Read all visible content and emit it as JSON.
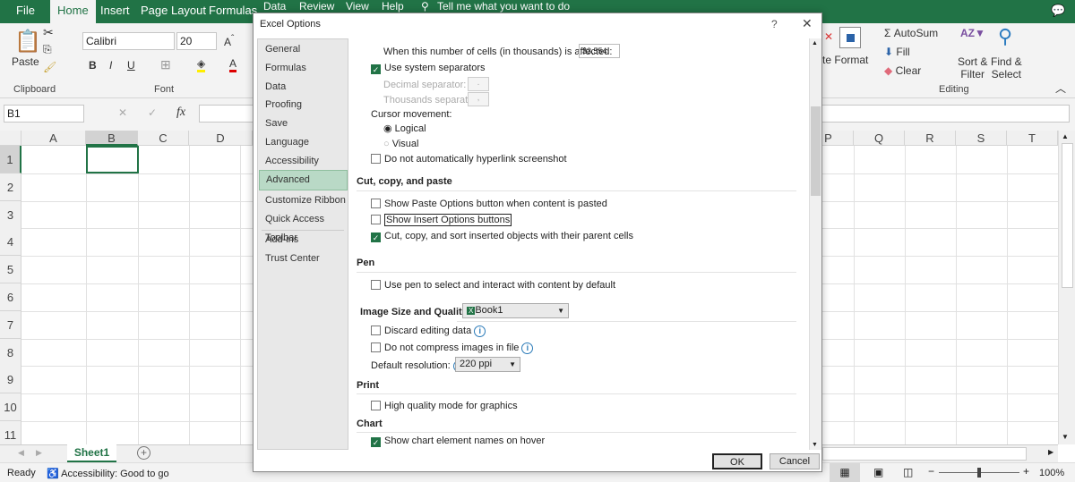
{
  "ribbon_tabs": [
    "File",
    "Home",
    "Insert",
    "Page Layout",
    "Formulas",
    "Data",
    "Review",
    "View",
    "Help",
    "Tell me what you want to do"
  ],
  "ribbon": {
    "paste": "Paste",
    "clipboard": "Clipboard",
    "font_name": "Calibri",
    "font_size": "20",
    "bold": "B",
    "italic": "I",
    "underline": "U",
    "font_group": "Font",
    "format": "Format",
    "autosum": "AutoSum",
    "fill": "Fill",
    "clear": "Clear",
    "sort_filter_1": "Sort &",
    "sort_filter_2": "Filter",
    "find_select_1": "Find &",
    "find_select_2": "Select",
    "editing": "Editing",
    "cells_partial": "te"
  },
  "formula_bar": {
    "name_box": "B1",
    "fx": "fx",
    "cancel": "✕",
    "enter": "✓"
  },
  "columns_left": [
    "A",
    "B",
    "C",
    "D"
  ],
  "columns_right": [
    "P",
    "Q",
    "R",
    "S",
    "T"
  ],
  "rows": [
    "1",
    "2",
    "3",
    "4",
    "5",
    "6",
    "7",
    "8",
    "9",
    "10",
    "11"
  ],
  "selected_cell": "B1",
  "sheet_tabs": [
    "Sheet1"
  ],
  "status": {
    "ready": "Ready",
    "accessibility": "Accessibility: Good to go",
    "zoom": "100%"
  },
  "dialog": {
    "title": "Excel Options",
    "help": "?",
    "close": "✕",
    "nav": [
      "General",
      "Formulas",
      "Data",
      "Proofing",
      "Save",
      "Language",
      "Accessibility",
      "Advanced",
      "Customize Ribbon",
      "Quick Access Toolbar",
      "Add-ins",
      "Trust Center"
    ],
    "selected_nav": "Advanced",
    "cells_affected_label": "When this number of cells (in thousands) is affected:",
    "cells_affected_value": "33,554",
    "use_system_separators": {
      "label": "Use system separators",
      "checked": true
    },
    "decimal_separator": {
      "label": "Decimal separator:",
      "value": "."
    },
    "thousands_separator": {
      "label": "Thousands separator:",
      "value": ","
    },
    "cursor_movement": "Cursor movement:",
    "logical": {
      "label": "Logical",
      "selected": true
    },
    "visual": {
      "label": "Visual",
      "selected": false
    },
    "no_hyperlink": {
      "label": "Do not automatically hyperlink screenshot",
      "checked": false
    },
    "sec_cut": "Cut, copy, and paste",
    "show_paste": {
      "label": "Show Paste Options button when content is pasted",
      "checked": false
    },
    "show_insert": {
      "label": "Show Insert Options buttons",
      "checked": false
    },
    "cut_sort": {
      "label": "Cut, copy, and sort inserted objects with their parent cells",
      "checked": true
    },
    "sec_pen": "Pen",
    "use_pen": {
      "label": "Use pen to select and interact with content by default",
      "checked": false
    },
    "sec_image": "Image Size and Quality",
    "image_book": "Book1",
    "discard": {
      "label": "Discard editing data",
      "checked": false
    },
    "no_compress": {
      "label": "Do not compress images in file",
      "checked": false
    },
    "default_res_label": "Default resolution:",
    "default_res_value": "220 ppi",
    "sec_print": "Print",
    "high_quality": {
      "label": "High quality mode for graphics",
      "checked": false
    },
    "sec_chart": "Chart",
    "chart_names": {
      "label": "Show chart element names on hover",
      "checked": true
    },
    "ok": "OK",
    "cancel": "Cancel"
  }
}
